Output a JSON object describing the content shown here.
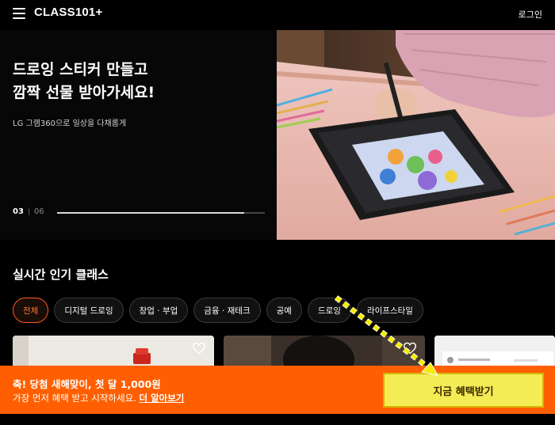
{
  "header": {
    "logo": "CLASS101+",
    "login_label": "로그인"
  },
  "hero": {
    "title_line1": "드로잉 스티커 만들고",
    "title_line2": "깜짝 선물 받아가세요!",
    "subtitle": "LG 그램360으로 일상을 다채롭게",
    "pager_current": "03",
    "pager_total": "06",
    "progress": 0.9
  },
  "section": {
    "title": "실시간 인기 클래스",
    "chips": [
      {
        "label": "전체",
        "active": true
      },
      {
        "label": "디지털 드로잉",
        "active": false
      },
      {
        "label": "창업 · 부업",
        "active": false
      },
      {
        "label": "금융 · 재테크",
        "active": false
      },
      {
        "label": "공예",
        "active": false
      },
      {
        "label": "드로잉",
        "active": false
      },
      {
        "label": "라이프스타일",
        "active": false
      }
    ]
  },
  "promo": {
    "line1": "축! 당첨 새해맞이, 첫 달 1,000원",
    "line2_prefix": "가장 먼저 혜택 받고 시작하세요.",
    "line2_link": "더 알아보기",
    "cta_label": "지금 혜택받기"
  },
  "colors": {
    "accent": "#ff5f00",
    "cta": "#f4ec55",
    "background": "#000000"
  }
}
